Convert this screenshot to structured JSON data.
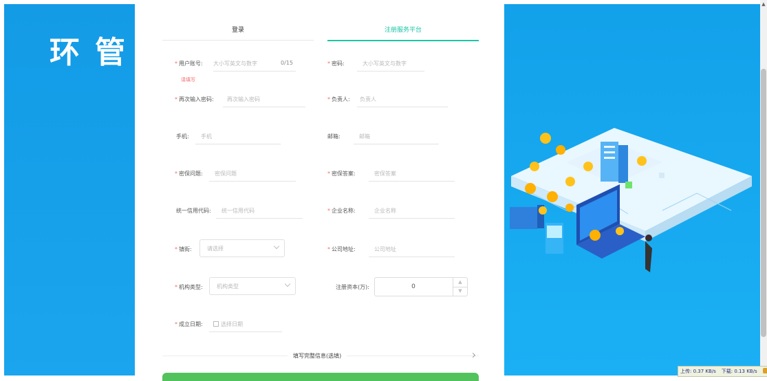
{
  "brand": {
    "title": "环管"
  },
  "tabs": {
    "login": "登录",
    "register": "注册服务平台"
  },
  "form": {
    "account": {
      "label": "用户账号:",
      "placeholder": "大小写英文与数字",
      "counter": "0/15",
      "error": "请填写"
    },
    "password": {
      "label": "密码:",
      "placeholder": "大小写英文与数字"
    },
    "confirm_password": {
      "label": "再次输入密码:",
      "placeholder": "再次输入密码"
    },
    "person_in_charge": {
      "label": "负责人:",
      "placeholder": "负责人"
    },
    "phone": {
      "label": "手机:",
      "placeholder": "手机"
    },
    "email": {
      "label": "邮箱:",
      "placeholder": "邮箱"
    },
    "security_question": {
      "label": "密保问题:",
      "placeholder": "密保问题"
    },
    "security_answer": {
      "label": "密保答案:",
      "placeholder": "密保答案"
    },
    "credit_code": {
      "label": "统一信用代码:",
      "placeholder": "统一信用代码"
    },
    "company_name": {
      "label": "企业名称:",
      "placeholder": "企业名称"
    },
    "street": {
      "label": "镇街:",
      "placeholder": "请选择"
    },
    "company_address": {
      "label": "公司地址:",
      "placeholder": "公司地址"
    },
    "org_type": {
      "label": "机构类型:",
      "placeholder": "机构类型"
    },
    "registered_capital": {
      "label": "注册资本(万):",
      "value": "0"
    },
    "established_date": {
      "label": "成立日期:",
      "placeholder": "选择日期"
    }
  },
  "more_info": "填写完整信息(选填)",
  "network": {
    "upload": "上传: 0.37 KB/s",
    "download": "下载: 0.13 KB/s"
  },
  "colors": {
    "accent": "#1cc4a7",
    "brand_blue": "#139be6",
    "submit_green": "#52c25d",
    "error": "#f56c6c"
  }
}
